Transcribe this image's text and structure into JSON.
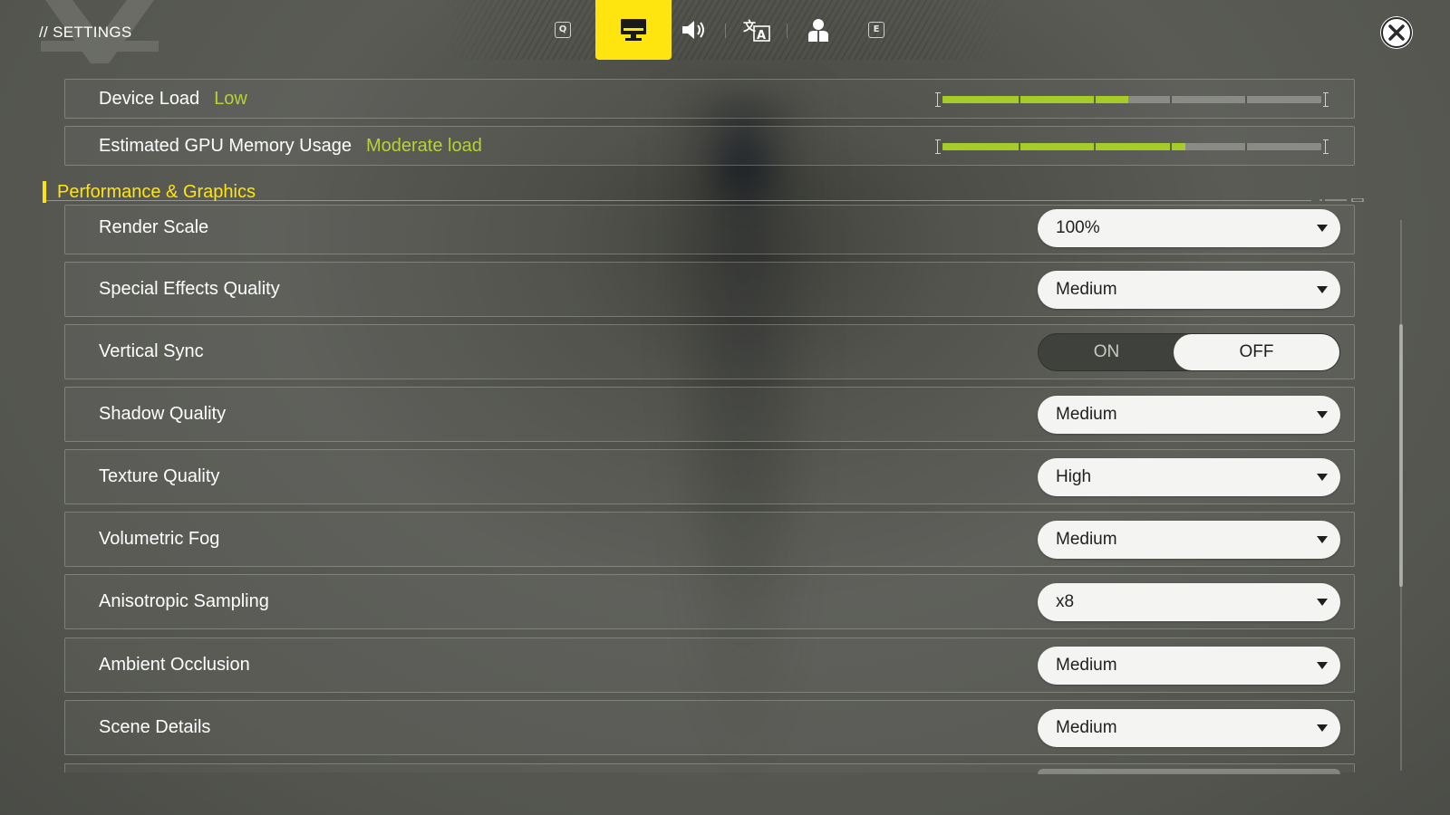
{
  "header": {
    "title": "// SETTINGS",
    "prev_key": "Q",
    "next_key": "E",
    "tabs": [
      {
        "icon": "monitor-icon",
        "active": true
      },
      {
        "icon": "speaker-icon",
        "active": false
      },
      {
        "icon": "translate-icon",
        "active": false
      },
      {
        "icon": "account-icon",
        "active": false
      }
    ],
    "accent_color": "#ffe510"
  },
  "device_load": {
    "label": "Device Load",
    "status": "Low",
    "level_fraction": 0.49
  },
  "gpu_memory": {
    "label": "Estimated GPU Memory Usage",
    "status": "Moderate load",
    "level_fraction": 0.64
  },
  "status_color": "#b5d336",
  "section": {
    "title": "Performance & Graphics"
  },
  "settings": {
    "render_scale": {
      "label": "Render Scale",
      "value": "100%"
    },
    "special_effects": {
      "label": "Special Effects Quality",
      "value": "Medium"
    },
    "vsync": {
      "label": "Vertical Sync",
      "on_label": "ON",
      "off_label": "OFF",
      "selected": "OFF"
    },
    "shadow": {
      "label": "Shadow Quality",
      "value": "Medium"
    },
    "texture": {
      "label": "Texture Quality",
      "value": "High"
    },
    "fog": {
      "label": "Volumetric Fog",
      "value": "Medium"
    },
    "aniso": {
      "label": "Anisotropic Sampling",
      "value": "x8"
    },
    "ao": {
      "label": "Ambient Occlusion",
      "value": "Medium"
    },
    "scene": {
      "label": "Scene Details",
      "value": "Medium"
    }
  }
}
